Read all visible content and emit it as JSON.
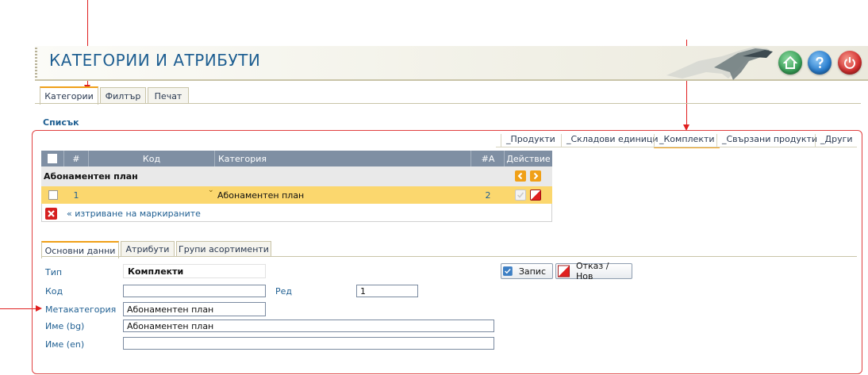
{
  "header": {
    "title": "КАТЕГОРИИ И АТРИБУТИ",
    "buttons": [
      {
        "name": "home-icon",
        "color": "#3aa35a"
      },
      {
        "name": "help-icon",
        "color": "#2a7fd0"
      },
      {
        "name": "power-icon",
        "color": "#d63030"
      }
    ]
  },
  "tabs": [
    {
      "label": "Категории",
      "active": true
    },
    {
      "label": "Филтър",
      "active": false
    },
    {
      "label": "Печат",
      "active": false
    }
  ],
  "list": {
    "title": "Списък",
    "subtabs": [
      {
        "label": "_Продукти",
        "active": false
      },
      {
        "label": "_Складови единици",
        "active": false
      },
      {
        "label": "_Комплекти",
        "active": true
      },
      {
        "label": "_Свързани продукти",
        "active": false
      },
      {
        "label": "_Други",
        "active": false
      }
    ],
    "columns": {
      "num": "#",
      "code": "Код",
      "category": "Категория",
      "count": "#A",
      "action": "Действие"
    },
    "group": {
      "label": "Абонаментен план"
    },
    "rows": [
      {
        "num": "1",
        "code": "",
        "category": "Абонаментен план",
        "count": "2"
      }
    ],
    "delete_marked": "« изтриване на маркираните"
  },
  "detail_tabs": [
    {
      "label": "Основни данни",
      "active": true
    },
    {
      "label": "Атрибути",
      "active": false
    },
    {
      "label": "Групи асортименти",
      "active": false
    }
  ],
  "form": {
    "type_label": "Тип",
    "type_value": "Комплекти",
    "code_label": "Код",
    "code_value": "",
    "order_label": "Ред",
    "order_value": "1",
    "meta_label": "Метакатегория",
    "meta_value": "Абонаментен план",
    "name_bg_label": "Име (bg)",
    "name_bg_value": "Абонаментен план",
    "name_en_label": "Име (en)",
    "name_en_value": "",
    "save_label": "Запис",
    "cancel_label": "Отказ / Нов"
  },
  "colors": {
    "accent": "#f0a018",
    "title": "#1f5f92",
    "selected_row": "#fbd76e",
    "annotation": "#e02020"
  }
}
